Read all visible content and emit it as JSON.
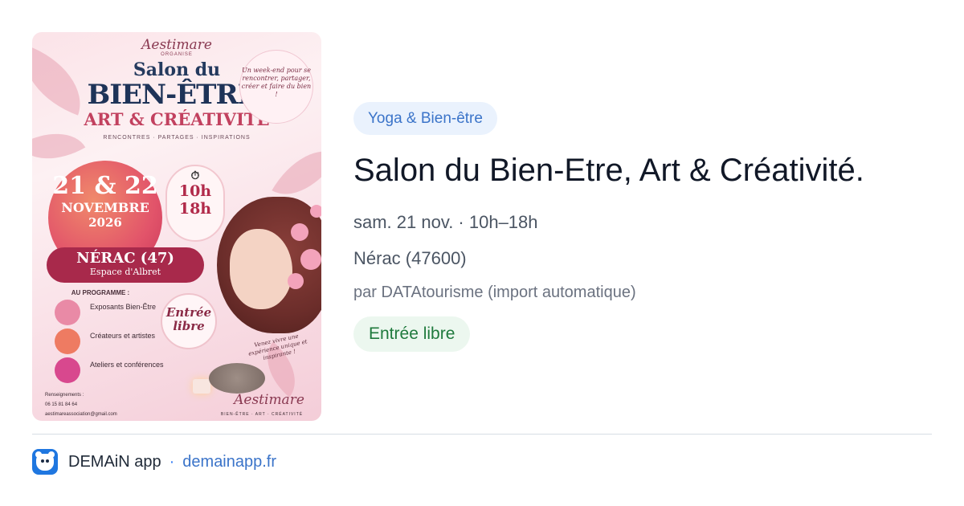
{
  "poster": {
    "brand": "Aestimare",
    "organise": "ORGANISE",
    "salon": "Salon du",
    "bien_etre": "BIEN-ÊTRE,",
    "art": "ART & CRÉATIVITÉ",
    "tags": "RENCONTRES · PARTAGES · INSPIRATIONS",
    "tagline": "Un week-end pour se rencontrer, partager, créer et faire du bien !",
    "date_days": "21 & 22",
    "date_month": "NOVEMBRE",
    "date_year": "2026",
    "hours_start": "10h",
    "hours_end": "18h",
    "location_city": "NÉRAC (47)",
    "location_venue": "Espace d'Albret",
    "program_title": "AU PROGRAMME :",
    "program": [
      {
        "label": "Exposants Bien-Être",
        "color": "#e98aa6"
      },
      {
        "label": "Créateurs et artistes",
        "color": "#ee7b62"
      },
      {
        "label": "Ateliers et conférences",
        "color": "#d8488e"
      }
    ],
    "entree": "Entrée libre",
    "venez": "Venez vivre une expérience unique et inspirante !",
    "brand_sub": "BIEN-ÊTRE · ART · CRÉATIVITÉ",
    "contact_title": "Renseignements :",
    "contact_phone": "06 15 81 84 64",
    "contact_email": "aestimareassociation@gmail.com"
  },
  "event": {
    "category": "Yoga & Bien-être",
    "title": "Salon du Bien-Etre, Art & Créativité.",
    "when": "sam. 21 nov. · 10h–18h",
    "where": "Nérac (47600)",
    "byline": "par DATAtourisme (import automatique)",
    "price_badge": "Entrée libre"
  },
  "footer": {
    "app_name": "DEMAiN app",
    "separator": "·",
    "domain": "demainapp.fr"
  },
  "colors": {
    "category_bg": "#eaf2fd",
    "category_text": "#3b74c9",
    "free_bg": "#ecf7ef",
    "free_text": "#1f7a3d",
    "link": "#3b74c9",
    "app_icon": "#1f77e0"
  }
}
